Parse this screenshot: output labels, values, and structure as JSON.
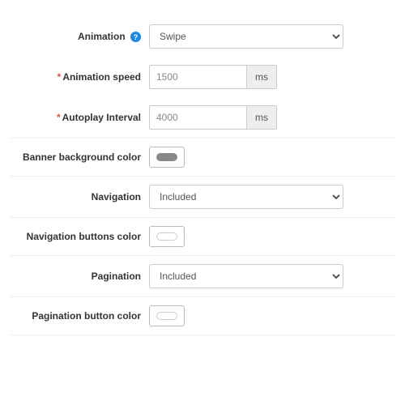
{
  "fields": {
    "animation": {
      "label": "Animation",
      "value": "Swipe"
    },
    "animation_speed": {
      "label": "Animation speed",
      "value": "1500",
      "unit": "ms"
    },
    "autoplay_interval": {
      "label": "Autoplay Interval",
      "value": "4000",
      "unit": "ms"
    },
    "banner_bg": {
      "label": "Banner background color",
      "color": "#888888"
    },
    "navigation": {
      "label": "Navigation",
      "value": "Included"
    },
    "nav_btn_color": {
      "label": "Navigation buttons color",
      "color": "#ffffff"
    },
    "pagination": {
      "label": "Pagination",
      "value": "Included"
    },
    "pag_btn_color": {
      "label": "Pagination button color",
      "color": "#ffffff"
    }
  }
}
